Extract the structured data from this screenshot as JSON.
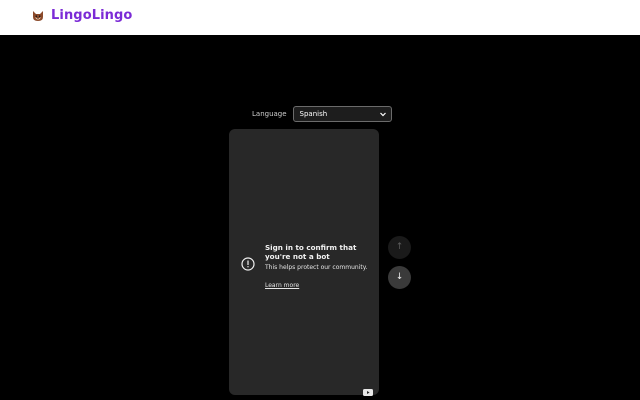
{
  "header": {
    "brand_name": "LingoLingo",
    "brand_icon": "fox-icon"
  },
  "language": {
    "label": "Language",
    "selected": "Spanish"
  },
  "player": {
    "notice_title": "Sign in to confirm that you're not a bot",
    "notice_subtitle": "This helps protect our community.",
    "learn_more": "Learn more",
    "badge_icon": "youtube-icon"
  },
  "nav": {
    "up_icon": "↑",
    "down_icon": "↓"
  },
  "colors": {
    "brand": "#7b2bd6",
    "background": "#000000",
    "card": "#282828"
  }
}
